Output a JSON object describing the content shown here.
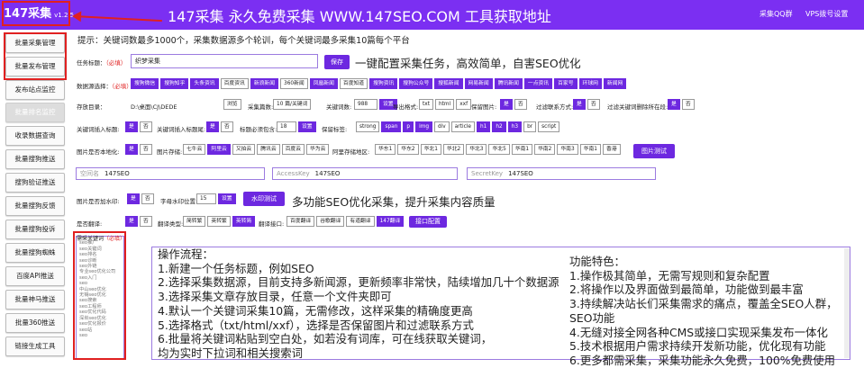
{
  "app": {
    "title": "147采集",
    "version": "v1.2.5",
    "headline": "147采集 永久免费采集 WWW.147SEO.COM 工具获取地址",
    "qq_group": "采集QQ群",
    "vps": "VPS拨号设置"
  },
  "sidebar": {
    "items": [
      {
        "label": "批量采集管理"
      },
      {
        "label": "批量发布管理"
      },
      {
        "label": "发布站点监控"
      },
      {
        "label": "批量排名监控"
      },
      {
        "label": "收录数据查询"
      },
      {
        "label": "批量搜狗推送"
      },
      {
        "label": "搜狗验证推送"
      },
      {
        "label": "批量搜狗反馈"
      },
      {
        "label": "批量搜狗投诉"
      },
      {
        "label": "批量搜狗蜘蛛"
      },
      {
        "label": "百度API推送"
      },
      {
        "label": "批量神马推送"
      },
      {
        "label": "批量360推送"
      },
      {
        "label": "链接生成工具"
      }
    ]
  },
  "tip": "提示：关键词数最多1000个，采集数据源多个轮训，每个关键词最多采集10篇每个平台",
  "task": {
    "label": "任务标题：",
    "req": "（必填）",
    "value": "织梦采集",
    "save": "保存",
    "promo": "一键配置采集任务，高效简单，自害SEO优化"
  },
  "sources": {
    "label": "数据源选择：",
    "req": "（必填）",
    "items": [
      {
        "t": "搜狗微信",
        "on": true
      },
      {
        "t": "搜狗知乎",
        "on": true
      },
      {
        "t": "头条资讯",
        "on": true
      },
      {
        "t": "百度资讯",
        "on": false
      },
      {
        "t": "新浪新闻",
        "on": true
      },
      {
        "t": "360新闻",
        "on": false
      },
      {
        "t": "凤凰新闻",
        "on": true
      },
      {
        "t": "百度知道",
        "on": false
      },
      {
        "t": "搜狗资讯",
        "on": true
      },
      {
        "t": "搜狗公众号",
        "on": true
      },
      {
        "t": "搜狐新闻",
        "on": true
      },
      {
        "t": "网易新闻",
        "on": true
      },
      {
        "t": "腾讯新闻",
        "on": true
      },
      {
        "t": "一点资讯",
        "on": true
      },
      {
        "t": "百家号",
        "on": true
      },
      {
        "t": "环球网",
        "on": true
      },
      {
        "t": "新闻网",
        "on": true
      }
    ]
  },
  "store": {
    "label": "存放目录：",
    "path": "D:\\桌面\\CJ\\DEDE",
    "browse": "浏览",
    "count_label": "采集篇数:",
    "count_value": "10",
    "count_unit": "篇/关键词",
    "kw_label": "关键词数:",
    "kw_value": "988",
    "export_label": "导出格式:",
    "formats": [
      {
        "t": "txt",
        "on": false
      },
      {
        "t": "html",
        "on": false
      },
      {
        "t": "xxf",
        "on": false
      }
    ],
    "img_label": "保留图片:",
    "yes": "是",
    "no": "否",
    "filter_label": "过滤联系方式:",
    "filter_del_label": "过滤关键词删除所在段:"
  },
  "kw": {
    "insert_label": "关键词插入标题:",
    "insert_title_label": "关键词插入标题尾:",
    "must_label": "标题必须包含:",
    "must_value": "18",
    "must_btn": "设置",
    "keep_label": "保留标签:",
    "tags": [
      {
        "t": "strong",
        "on": false
      },
      {
        "t": "span",
        "on": true
      },
      {
        "t": "p",
        "on": true
      },
      {
        "t": "img",
        "on": true
      },
      {
        "t": "div",
        "on": false
      },
      {
        "t": "article",
        "on": false
      },
      {
        "t": "h1",
        "on": true
      },
      {
        "t": "h2",
        "on": true
      },
      {
        "t": "h3",
        "on": true
      },
      {
        "t": "br",
        "on": false
      },
      {
        "t": "script",
        "on": false
      }
    ]
  },
  "img": {
    "local_label": "图片是否本地化:",
    "store_label": "图片存储:",
    "stores": [
      {
        "t": "七牛云",
        "on": false
      },
      {
        "t": "阿里云",
        "on": true
      },
      {
        "t": "又拍云",
        "on": false
      },
      {
        "t": "腾讯云",
        "on": false
      },
      {
        "t": "百度云",
        "on": false
      },
      {
        "t": "华为云",
        "on": false
      }
    ],
    "region_label": "阿里存储地区:",
    "regions": [
      "华东1",
      "华东2",
      "华北1",
      "华北2",
      "华北3",
      "华北5",
      "华南1",
      "华南2",
      "华南3",
      "华南1",
      "香港"
    ],
    "test": "图片测试"
  },
  "keys": {
    "space_ph": "空间名",
    "space_val": "147SEO",
    "ak_ph": "AccessKey",
    "ak_val": "147SEO",
    "sk_ph": "SecretKey",
    "sk_val": "147SEO"
  },
  "wm": {
    "label": "图片是否加水印:",
    "pos_label": "字母水印位置:",
    "pos_value": "15",
    "pos_btn": "设置",
    "test": "水印测试",
    "promo": "多功能SEO优化采集，提升采集内容质量"
  },
  "translate": {
    "label": "是否翻译:",
    "type_label": "翻译类型:",
    "types": [
      {
        "t": "简转繁",
        "on": false
      },
      {
        "t": "英转繁",
        "on": false
      },
      {
        "t": "英转简",
        "on": true
      }
    ],
    "api_label": "翻译接口:",
    "apis": [
      {
        "t": "百度翻译",
        "on": false
      },
      {
        "t": "谷歌翻译",
        "on": false
      },
      {
        "t": "有道翻译",
        "on": false
      },
      {
        "t": "147翻译",
        "on": true
      }
    ],
    "config": "接口配置"
  },
  "keywords": {
    "label": "需采关键词",
    "req": "（必填）",
    "list": [
      "seo",
      "seo推广",
      "seo关键词",
      "seo排名",
      "seo诊断",
      "seo外链",
      "专业seo优化公司",
      "seo入门",
      "seo",
      "中山seo优化",
      "无锡seo优化",
      "seo搜索",
      "seo工程师",
      "seo优化代码",
      "深圳seo优化",
      "seo优化报价",
      "seo站",
      "seo"
    ]
  },
  "flow": {
    "title": "操作流程：",
    "lines": [
      "1.新建一个任务标题，例如SEO",
      "2.选择采集数据源，目前支持多新闻源，更新频率非常快，陆续增加几十个数据源",
      "3.选择采集文章存放目录，任意一个文件夹即可",
      "4.默认一个关键词采集10篇，无需修改，这样采集的精确度更高",
      "5.选择格式（txt/html/xxf），选择是否保留图片和过滤联系方式",
      "6.批量将关键词粘贴到空白处，如若没有词库，可在线获取关键词，",
      "均为实时下拉词和相关搜索词"
    ]
  },
  "features": {
    "title": "功能特色：",
    "lines": [
      "1.操作极其简单，无需写规则和复杂配置",
      "2.将操作以及界面做到最简单，功能做到最丰富",
      "3.持续解决站长们采集需求的痛点，覆盖全SEO人群，",
      "SEO功能",
      "4.无缝对接全网各种CMS或接口实现采集发布一体化",
      "5.技术根据用户需求持续开发新功能，优化现有功能",
      "6.更多都需采集，采集功能永久免费，100%免费使用"
    ]
  }
}
